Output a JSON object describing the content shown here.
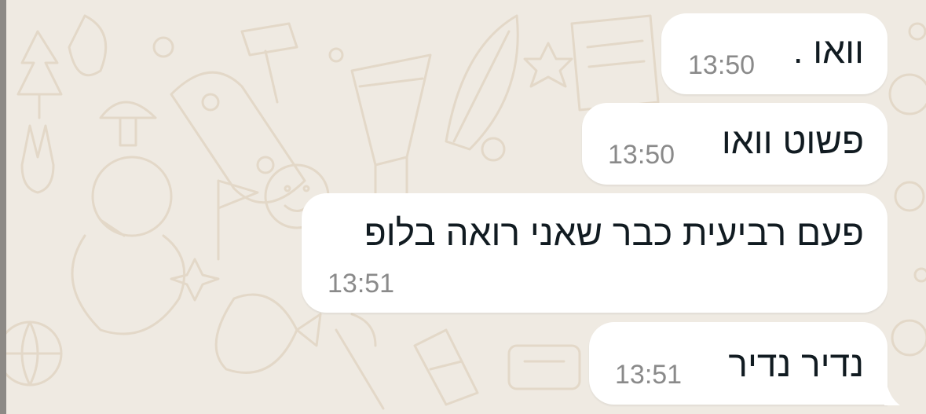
{
  "chat": {
    "messages": [
      {
        "text": "וואו .",
        "time": "13:50"
      },
      {
        "text": "פשוט וואו",
        "time": "13:50"
      },
      {
        "text": "פעם רביעית כבר שאני רואה בלופ",
        "time": "13:51"
      },
      {
        "text": "נדיר נדיר",
        "time": "13:51"
      }
    ]
  },
  "colors": {
    "background": "#efeae2",
    "bubble": "#ffffff",
    "doodle": "#e3d8c8",
    "text": "#111b21",
    "timestamp": "#8a8a8a"
  }
}
